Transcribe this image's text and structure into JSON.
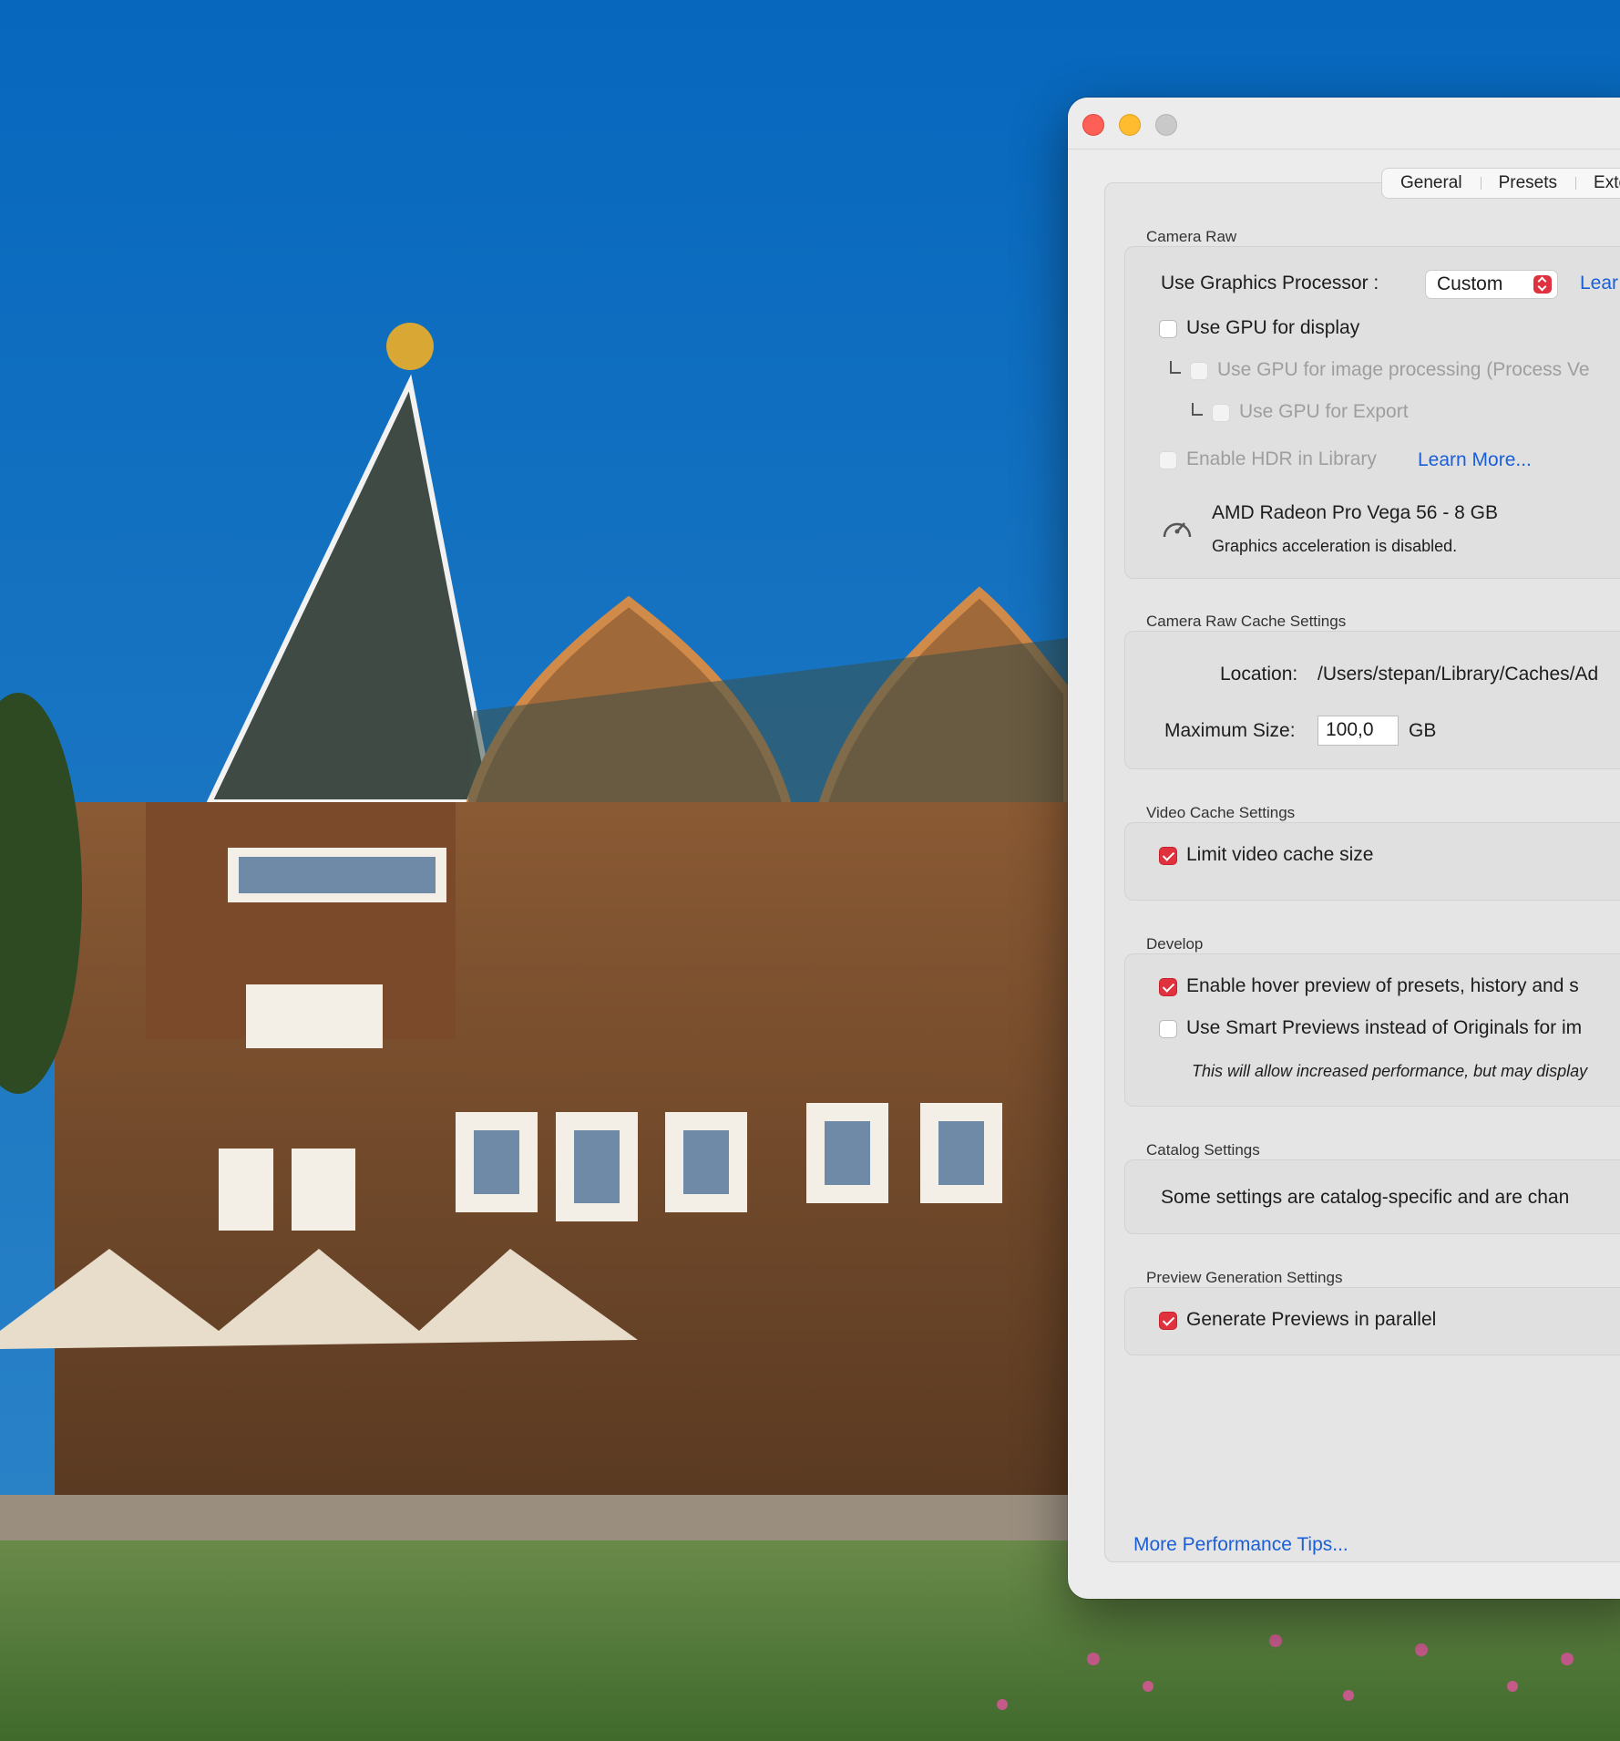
{
  "window": {
    "tabs": [
      "General",
      "Presets",
      "Exte"
    ]
  },
  "camera_raw": {
    "section_title": "Camera Raw",
    "graphics_processor_label": "Use Graphics Processor :",
    "graphics_processor_value": "Custom",
    "learn_link_cut": "Lear",
    "use_gpu_display": "Use GPU for display",
    "use_gpu_image_processing": "Use GPU for image processing (Process Ve",
    "use_gpu_export": "Use GPU for Export",
    "enable_hdr": "Enable HDR in Library",
    "learn_more": "Learn More...",
    "gpu_name": "AMD Radeon Pro Vega 56 - 8 GB",
    "gpu_status": "Graphics acceleration is disabled."
  },
  "cache": {
    "section_title": "Camera Raw Cache Settings",
    "location_label": "Location:",
    "location_value": "/Users/stepan/Library/Caches/Ad",
    "max_size_label": "Maximum Size:",
    "max_size_value": "100,0",
    "unit": "GB"
  },
  "video_cache": {
    "section_title": "Video Cache Settings",
    "limit_label": "Limit video cache size"
  },
  "develop": {
    "section_title": "Develop",
    "hover_preview": "Enable hover preview of presets, history and s",
    "smart_previews": "Use Smart Previews instead of Originals for im",
    "note": "This will allow increased performance, but may display"
  },
  "catalog": {
    "section_title": "Catalog Settings",
    "text": "Some settings are catalog-specific and are chan"
  },
  "preview_gen": {
    "section_title": "Preview Generation Settings",
    "parallel": "Generate Previews in parallel"
  },
  "footer": {
    "more_tips": "More Performance Tips..."
  },
  "colors": {
    "accent_checkbox": "#e0313e",
    "link": "#1a5fd8",
    "sky": "#0a6cc0"
  }
}
